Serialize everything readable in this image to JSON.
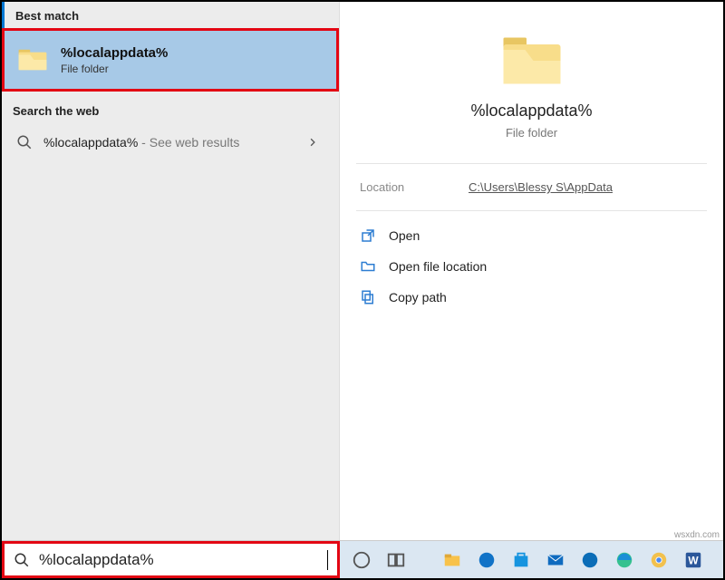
{
  "left": {
    "best_match_header": "Best match",
    "item": {
      "title": "%localappdata%",
      "subtitle": "File folder"
    },
    "web_header": "Search the web",
    "web_item": {
      "term": "%localappdata%",
      "hint": " - See web results"
    }
  },
  "preview": {
    "title": "%localappdata%",
    "subtitle": "File folder",
    "location_label": "Location",
    "location_value": "C:\\Users\\Blessy S\\AppData",
    "actions": {
      "open": "Open",
      "open_location": "Open file location",
      "copy_path": "Copy path"
    }
  },
  "search": {
    "value": "%localappdata%"
  },
  "attribution": "wsxdn.com"
}
